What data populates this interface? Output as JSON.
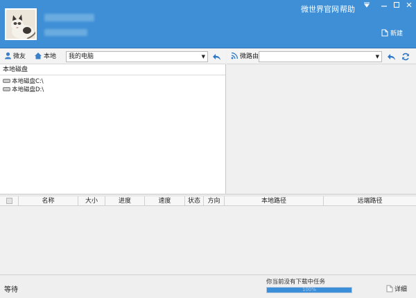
{
  "header": {
    "links": [
      "微世界",
      "官网",
      "帮助"
    ],
    "new_label": "新建"
  },
  "left_toolbar": {
    "friends_label": "微友",
    "local_label": "本地",
    "location_value": "我的电脑"
  },
  "right_toolbar": {
    "router_label": "微路由",
    "location_value": ""
  },
  "left_panel": {
    "header": "本地磁盘",
    "drives": [
      "本地磁盘C:\\",
      "本地磁盘D:\\"
    ]
  },
  "table": {
    "columns": [
      "名称",
      "大小",
      "进度",
      "速度",
      "状态",
      "方向",
      "本地路径",
      "远端路径"
    ]
  },
  "status": {
    "state": "等待",
    "message": "你当前没有下载中任务",
    "progress_text": "100%",
    "progress": 1.0,
    "detail_label": "详细"
  },
  "colors": {
    "header_bg": "#3f8fd6",
    "accent": "#3b8fd8"
  }
}
